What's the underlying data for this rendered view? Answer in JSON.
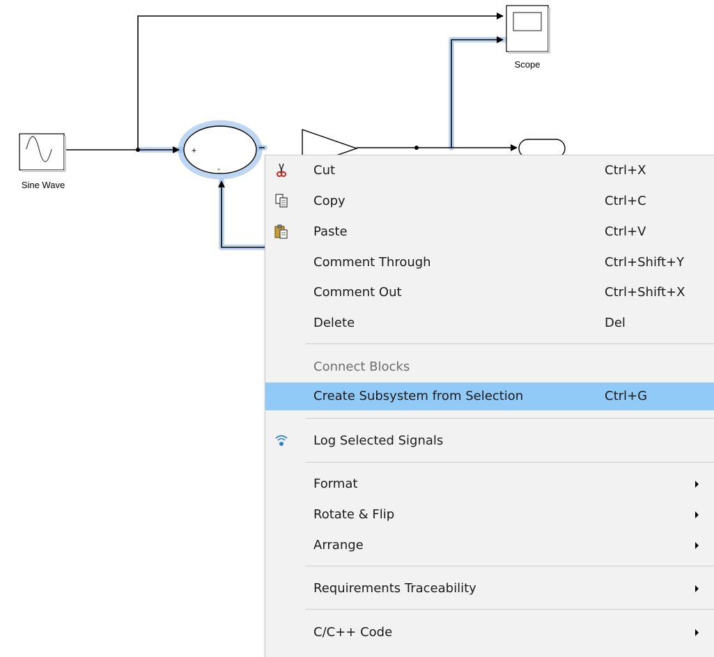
{
  "diagram": {
    "blocks": {
      "sine_wave": {
        "label": "Sine Wave",
        "icon": "sine-wave-icon"
      },
      "scope": {
        "label": "Scope",
        "icon": "scope-icon"
      },
      "sum": {
        "icon": "sum-icon",
        "plus_sign": "+",
        "minus_sign": "-"
      },
      "gain": {
        "icon": "gain-icon"
      },
      "outport": {
        "icon": "outport-icon"
      }
    },
    "selection_color": "#8ab4e8"
  },
  "context_menu": {
    "highlight_color": "#91c9f7",
    "items": [
      {
        "label": "Cut",
        "shortcut": "Ctrl+X",
        "icon": "scissors-icon"
      },
      {
        "label": "Copy",
        "shortcut": "Ctrl+C",
        "icon": "copy-icon"
      },
      {
        "label": "Paste",
        "shortcut": "Ctrl+V",
        "icon": "paste-icon"
      },
      {
        "label": "Comment Through",
        "shortcut": "Ctrl+Shift+Y"
      },
      {
        "label": "Comment Out",
        "shortcut": "Ctrl+Shift+X"
      },
      {
        "label": "Delete",
        "shortcut": "Del"
      },
      {
        "label": "Connect Blocks",
        "disabled": true
      },
      {
        "label": "Create Subsystem from Selection",
        "shortcut": "Ctrl+G",
        "highlighted": true
      },
      {
        "label": "Log Selected Signals",
        "icon": "signal-logging-icon"
      },
      {
        "label": "Format",
        "submenu": true
      },
      {
        "label": "Rotate & Flip",
        "submenu": true
      },
      {
        "label": "Arrange",
        "submenu": true
      },
      {
        "label": "Requirements Traceability",
        "submenu": true
      },
      {
        "label": "C/C++ Code",
        "submenu": true
      }
    ]
  }
}
